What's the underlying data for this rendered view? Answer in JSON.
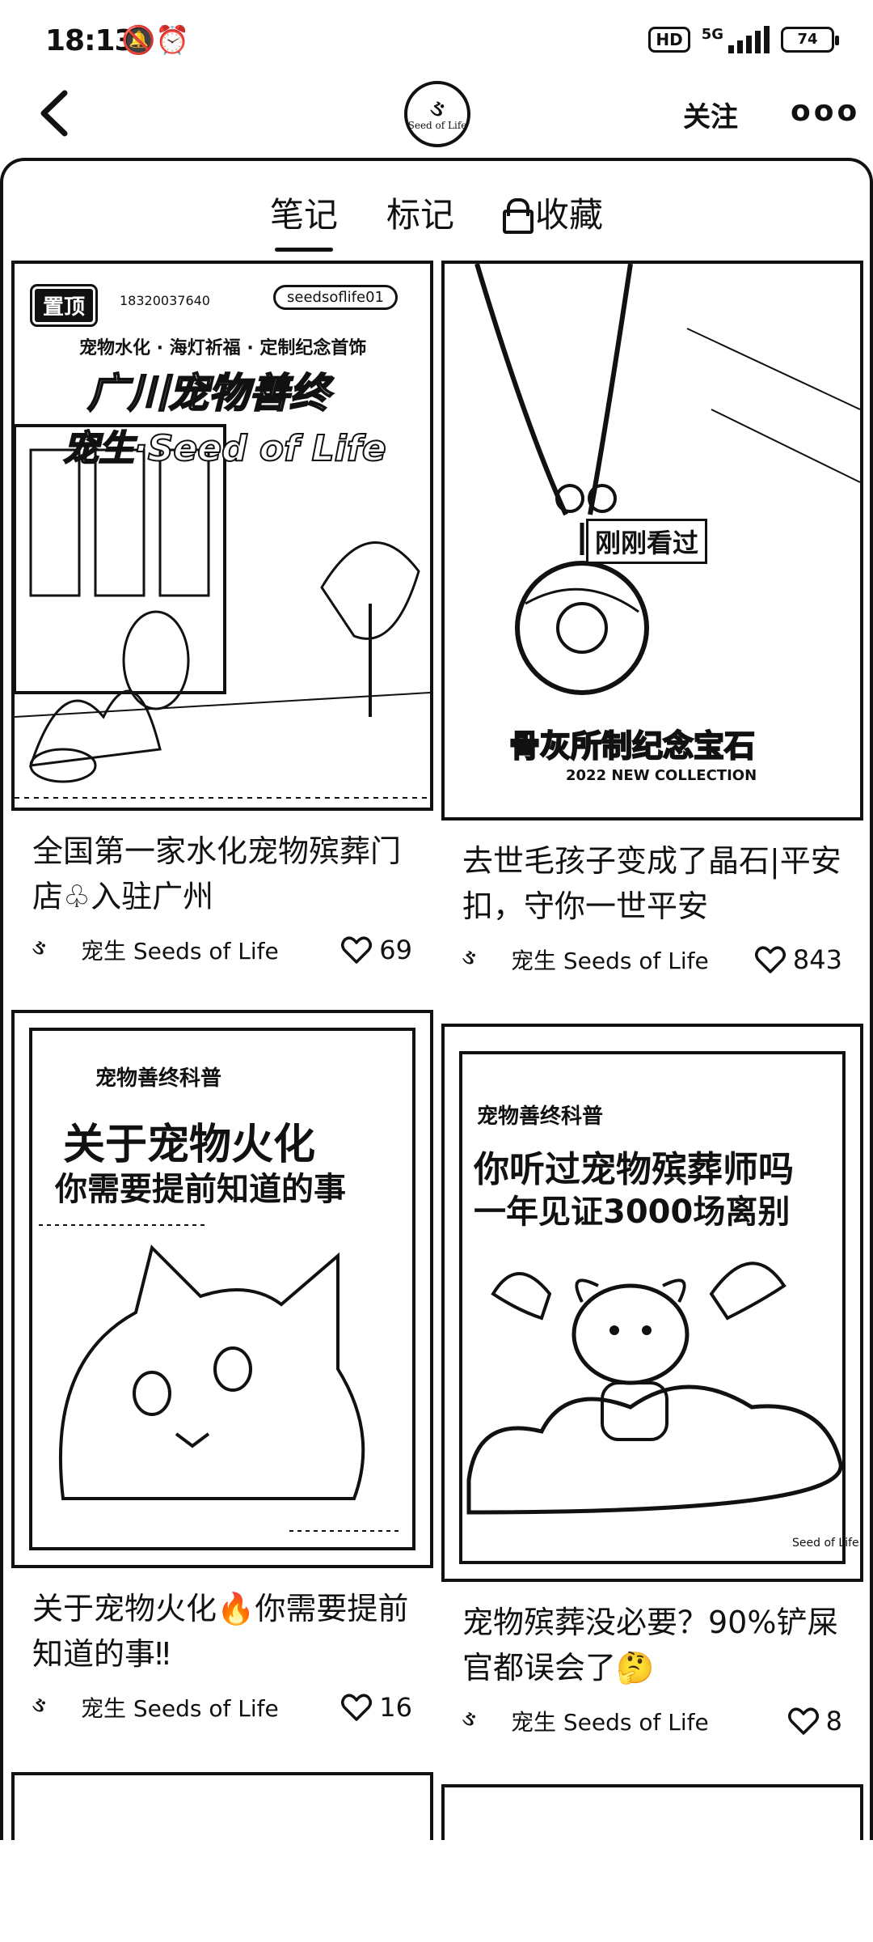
{
  "status": {
    "time": "18:13",
    "status_icons": "🔕⏰",
    "hd": "HD",
    "network": "5G",
    "battery": "74"
  },
  "header": {
    "logo_text": "Seed of Life",
    "follow_label": "关注",
    "more_label": "ooo"
  },
  "tabs": [
    {
      "label": "笔记"
    },
    {
      "label": "标记"
    },
    {
      "label": "收藏"
    }
  ],
  "cards": [
    {
      "title": "全国第一家水化宠物殡葬门店♧入驻广州",
      "author": "宠生 Seeds of Life",
      "likes": "69",
      "image": {
        "pin": "置顶",
        "phone": "18320037640",
        "wechat": "seedsoflife01",
        "sub": "宠物水化 · 海灯祈福 · 定制纪念首饰",
        "headline_1": "广川宠物善终",
        "headline_2": "宠生·Seed of Life"
      }
    },
    {
      "title": "去世毛孩子变成了晶石|平安扣，守你一世平安",
      "author": "宠生 Seeds of Life",
      "likes": "843",
      "image": {
        "recent": "刚刚看过",
        "caption": "骨灰所制纪念宝石",
        "collection": "2022 NEW COLLECTION"
      }
    },
    {
      "title": "关于宠物火化🔥你需要提前知道的事‼",
      "author": "宠生 Seeds of Life",
      "likes": "16",
      "image": {
        "brand": "宠物善终科普",
        "headline_1": "关于宠物火化",
        "headline_2": "你需要提前知道的事"
      }
    },
    {
      "title": "宠物殡葬没必要？90%铲屎官都误会了🤔",
      "author": "宠生 Seeds of Life",
      "likes": "8",
      "image": {
        "brand": "宠物善终科普",
        "headline_1": "你听过宠物殡葬师吗",
        "headline_2": "一年见证3000场离别",
        "logo": "Seed of Life"
      }
    }
  ]
}
